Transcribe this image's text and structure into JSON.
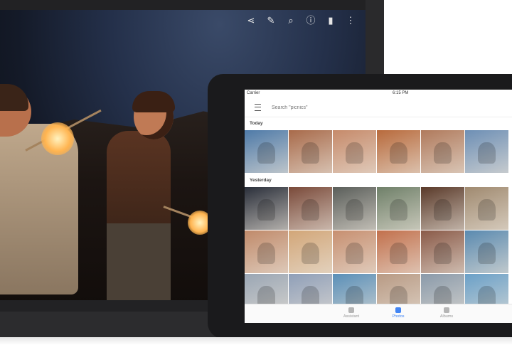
{
  "back_device": {
    "toolbar": [
      {
        "name": "share-icon",
        "glyph": "⋖"
      },
      {
        "name": "edit-icon",
        "glyph": "✎"
      },
      {
        "name": "zoom-icon",
        "glyph": "⌕"
      },
      {
        "name": "info-icon",
        "glyph": "ⓘ"
      },
      {
        "name": "delete-icon",
        "glyph": "▮"
      },
      {
        "name": "more-icon",
        "glyph": "⋮"
      }
    ]
  },
  "tablet": {
    "status": {
      "carrier": "Carrier",
      "time": "6:15 PM"
    },
    "search": {
      "placeholder": "Search \"picnics\""
    },
    "sections": [
      {
        "label": "Today",
        "thumbs": [
          "#4e7aa8",
          "#a86a4a",
          "#c68a6a",
          "#b86a3c",
          "#b07a5c",
          "#6d8fb5"
        ]
      },
      {
        "label": "Yesterday",
        "thumbs": [
          "#2a2f3a",
          "#7a4a3a",
          "#5a5e5a",
          "#6f8069",
          "#5a3a2a",
          "#a08a70",
          "#c08a6a",
          "#d2a678",
          "#c78f70",
          "#c2704c",
          "#8a5a48",
          "#5a8ab0",
          "#9aa6b4",
          "#8f9fb8",
          "#5a8fb8",
          "#b89a84",
          "#8a9aaa",
          "#6aa0c8"
        ]
      }
    ],
    "nav": [
      {
        "label": "Assistant",
        "active": false
      },
      {
        "label": "Photos",
        "active": true
      },
      {
        "label": "Albums",
        "active": false
      }
    ]
  }
}
